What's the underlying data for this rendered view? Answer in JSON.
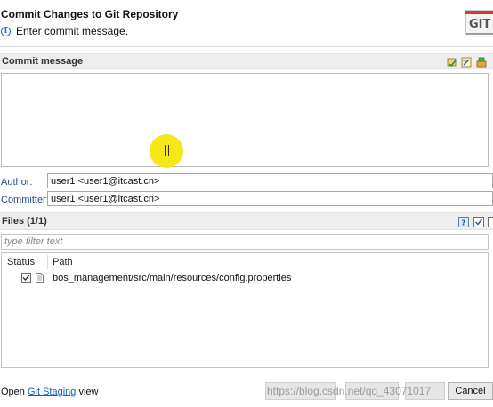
{
  "dialog": {
    "title": "Commit Changes to Git Repository",
    "info_text": "Enter commit message.",
    "logo_text": "GIT"
  },
  "commit_message": {
    "section_label": "Commit message",
    "value": ""
  },
  "author": {
    "label": "Author:",
    "value": "user1 <user1@itcast.cn>"
  },
  "committer": {
    "label": "Committer:",
    "value": "user1 <user1@itcast.cn>"
  },
  "files": {
    "section_label": "Files (1/1)",
    "filter_placeholder": "type filter text",
    "columns": {
      "status": "Status",
      "path": "Path"
    },
    "rows": [
      {
        "checked": true,
        "path": "bos_management/src/main/resources/config.properties"
      }
    ]
  },
  "footer": {
    "open_prefix": "Open ",
    "link": "Git Staging",
    "suffix": " view",
    "watermark": "https://blog.csdn.net/qq_43071017",
    "cancel_label": "Cancel"
  },
  "colors": {
    "link": "#1a5fb4",
    "label": "#1f4f8f",
    "cursor_highlight": "#f5e400"
  }
}
